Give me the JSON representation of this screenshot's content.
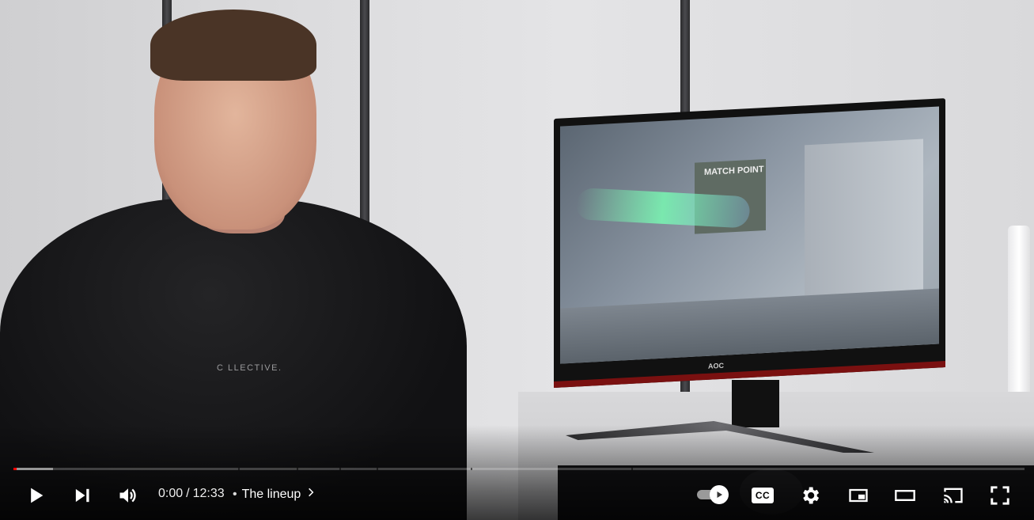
{
  "video": {
    "shirt_print": "C LLECTIVE.",
    "monitor_hud_text": "MATCH POINT",
    "monitor_brand": "AOC"
  },
  "progress": {
    "played_fraction": 0.003,
    "buffered_fraction": 0.039,
    "accent_color": "#ff0000"
  },
  "controls": {
    "play_icon": "play-icon",
    "next_icon": "next-icon",
    "volume_icon": "volume-icon",
    "current_time": "0:00",
    "time_separator": "/",
    "duration": "12:33",
    "chapter_separator": "•",
    "chapter_title": "The lineup",
    "autoplay_icon": "autoplay-toggle-icon",
    "cc_label": "CC",
    "settings_icon": "gear-icon",
    "miniplayer_icon": "miniplayer-icon",
    "theater_icon": "theater-mode-icon",
    "cast_icon": "cast-icon",
    "fullscreen_icon": "fullscreen-icon"
  }
}
